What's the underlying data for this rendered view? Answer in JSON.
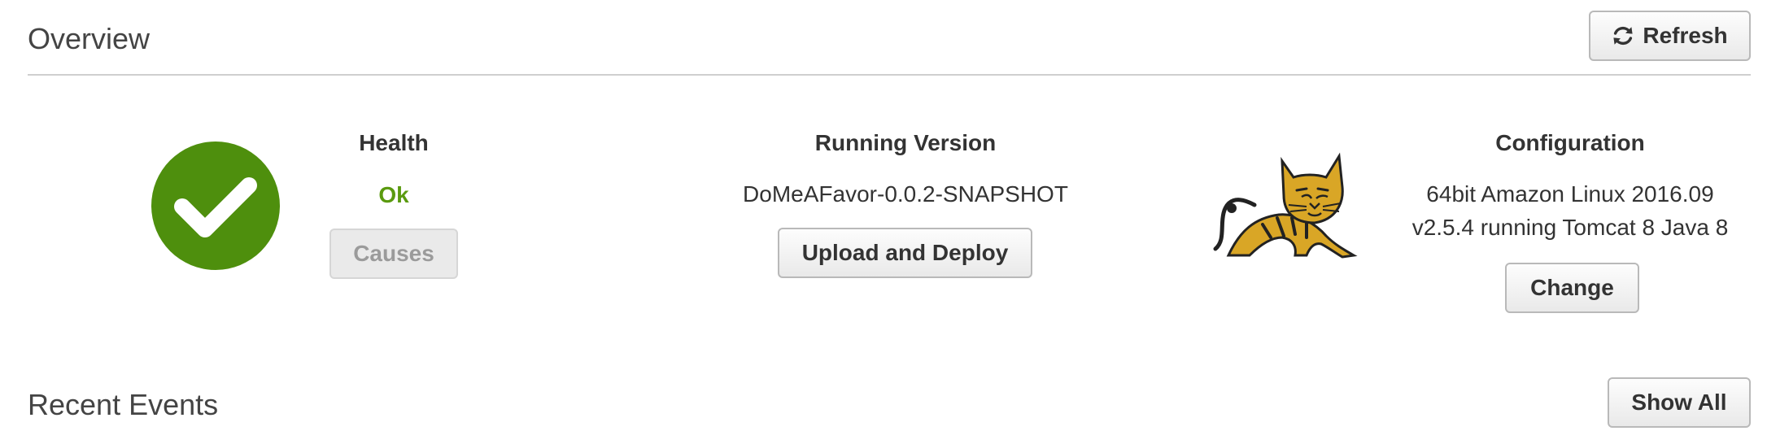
{
  "overview": {
    "title": "Overview",
    "refresh_label": "Refresh"
  },
  "health": {
    "heading": "Health",
    "status": "Ok",
    "causes_label": "Causes"
  },
  "running_version": {
    "heading": "Running Version",
    "version": "DoMeAFavor-0.0.2-SNAPSHOT",
    "deploy_label": "Upload and Deploy"
  },
  "configuration": {
    "heading": "Configuration",
    "line1": "64bit Amazon Linux 2016.09",
    "line2": "v2.5.4 running Tomcat 8 Java 8",
    "change_label": "Change"
  },
  "recent_events": {
    "title": "Recent Events",
    "show_all_label": "Show All"
  },
  "icons": {
    "refresh": "refresh-icon",
    "health": "check-circle-icon",
    "platform": "tomcat-logo"
  },
  "colors": {
    "health_ok": "#4e8f0d",
    "status_text_ok": "#5a9a0f",
    "tomcat_yellow": "#d9a626"
  }
}
